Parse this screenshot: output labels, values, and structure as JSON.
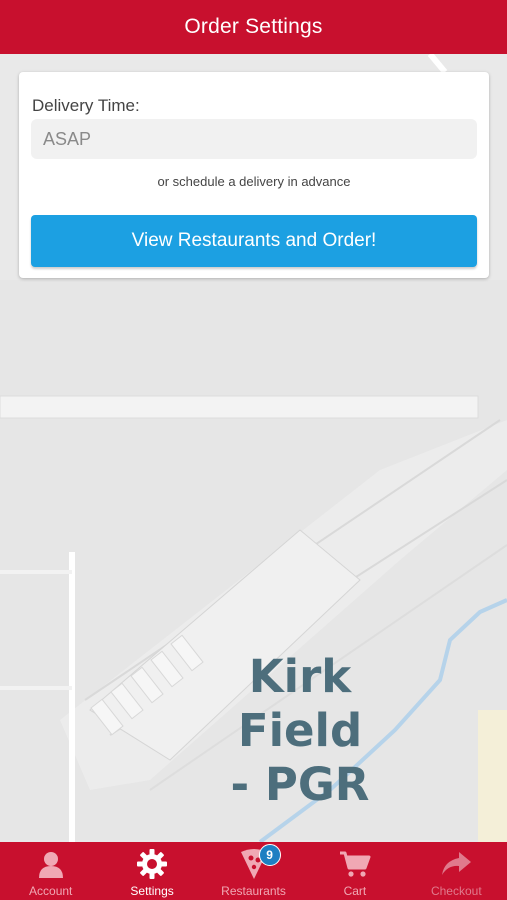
{
  "header": {
    "title": "Order Settings"
  },
  "order_card": {
    "delivery_time_label": "Delivery Time:",
    "delivery_time_value": "ASAP",
    "schedule_link": "or schedule a delivery in advance",
    "order_button": "View Restaurants and Order!"
  },
  "map": {
    "place_label_line1": "Kirk Field",
    "place_label_line2": "- PGR"
  },
  "tabbar": {
    "account": "Account",
    "settings": "Settings",
    "restaurants": "Restaurants",
    "restaurants_badge": "9",
    "cart": "Cart",
    "checkout": "Checkout"
  },
  "colors": {
    "brand_red": "#c8102e",
    "button_blue": "#1ca0e2",
    "badge_blue": "#1e7fc2"
  },
  "icons": [
    "user-icon",
    "gear-icon",
    "pizza-icon",
    "cart-icon",
    "share-arrow-icon"
  ]
}
